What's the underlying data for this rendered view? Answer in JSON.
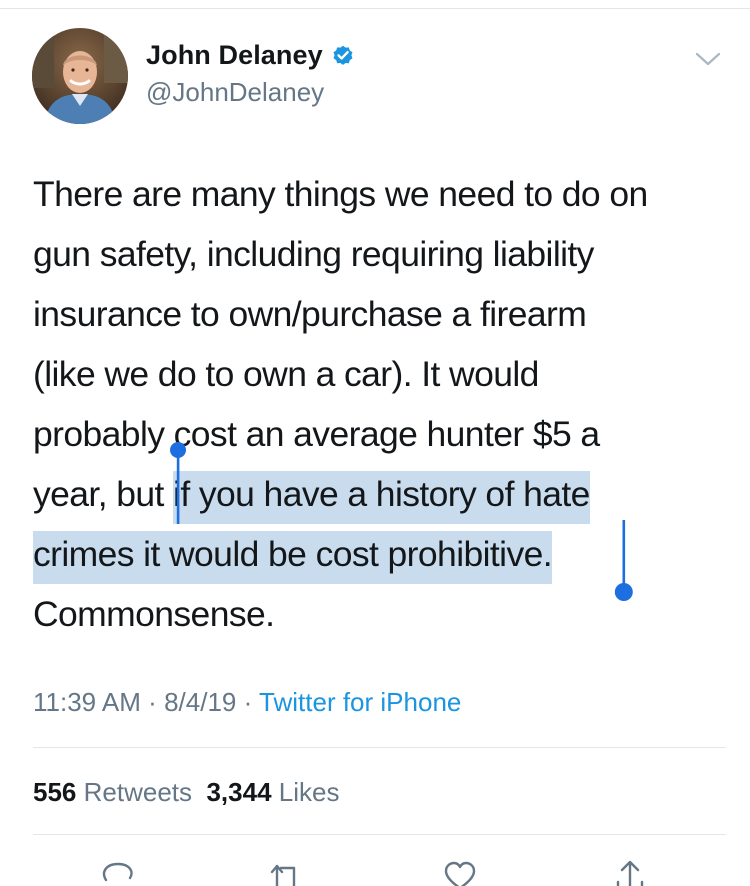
{
  "author": {
    "display_name": "John Delaney",
    "handle": "@JohnDelaney",
    "verified": true,
    "avatar_icon": "profile-photo"
  },
  "tweet": {
    "lines": [
      {
        "text": "There are many things we need to do on"
      },
      {
        "text": "gun safety, including requiring liability"
      },
      {
        "text": "insurance to own/purchase a firearm"
      },
      {
        "text": "(like we do to own a car). It would"
      },
      {
        "text": "probably cost an average hunter $5 a"
      },
      {
        "before": "year, but ",
        "selected": "if you have a history of hate"
      },
      {
        "selected": "crimes it would be cost prohibitive."
      },
      {
        "text": "Commonsense."
      }
    ]
  },
  "meta": {
    "time": "11:39 AM",
    "date": "8/4/19",
    "separator": "·",
    "source": "Twitter for iPhone"
  },
  "stats": {
    "retweets_count": "556",
    "retweets_label": "Retweets",
    "likes_count": "3,344",
    "likes_label": "Likes"
  },
  "actions": [
    "reply-icon",
    "retweet-icon",
    "like-icon",
    "share-icon"
  ],
  "colors": {
    "text": "#14171a",
    "secondary": "#657786",
    "accent": "#1b95e0",
    "selection": "#c9dcee",
    "selection_handle": "#1d6fe0",
    "divider": "#e1e8ed"
  }
}
